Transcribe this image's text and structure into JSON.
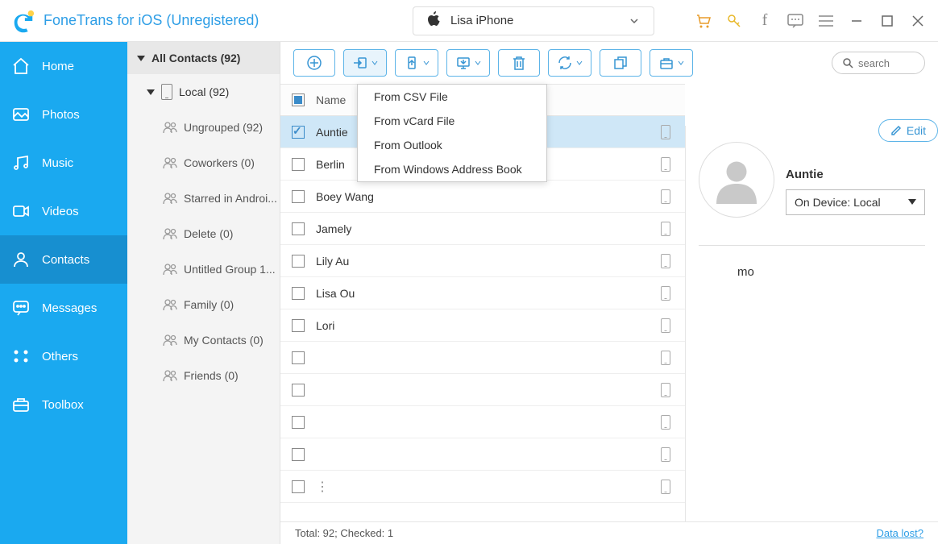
{
  "app_title": "FoneTrans for iOS (Unregistered)",
  "device": "Lisa iPhone",
  "search_placeholder": "search",
  "sidebar": [
    {
      "id": "home",
      "label": "Home"
    },
    {
      "id": "photos",
      "label": "Photos"
    },
    {
      "id": "music",
      "label": "Music"
    },
    {
      "id": "videos",
      "label": "Videos"
    },
    {
      "id": "contacts",
      "label": "Contacts"
    },
    {
      "id": "messages",
      "label": "Messages"
    },
    {
      "id": "others",
      "label": "Others"
    },
    {
      "id": "toolbox",
      "label": "Toolbox"
    }
  ],
  "sidebar_active": "contacts",
  "groups": {
    "header": "All Contacts  (92)",
    "local": "Local  (92)",
    "items": [
      "Ungrouped  (92)",
      "Coworkers  (0)",
      "Starred in Androi...",
      "Delete  (0)",
      "Untitled Group 1...",
      "Family  (0)",
      "My Contacts  (0)",
      "Friends  (0)"
    ]
  },
  "dropdown": [
    "From CSV File",
    "From vCard File",
    "From Outlook",
    "From Windows Address Book"
  ],
  "list_header": "Name",
  "contacts": [
    {
      "name": "Auntie",
      "checked": true,
      "selected": true
    },
    {
      "name": "Berlin"
    },
    {
      "name": "Boey Wang"
    },
    {
      "name": "Jamely"
    },
    {
      "name": "Lily Au"
    },
    {
      "name": "Lisa Ou"
    },
    {
      "name": "Lori"
    },
    {
      "name": ""
    },
    {
      "name": ""
    },
    {
      "name": ""
    },
    {
      "name": ""
    },
    {
      "name": "",
      "dots": true
    }
  ],
  "status": {
    "text": "Total: 92; Checked: 1",
    "link": "Data lost?"
  },
  "detail": {
    "edit": "Edit",
    "name": "Auntie",
    "device": "On Device: Local",
    "field": "mo"
  }
}
